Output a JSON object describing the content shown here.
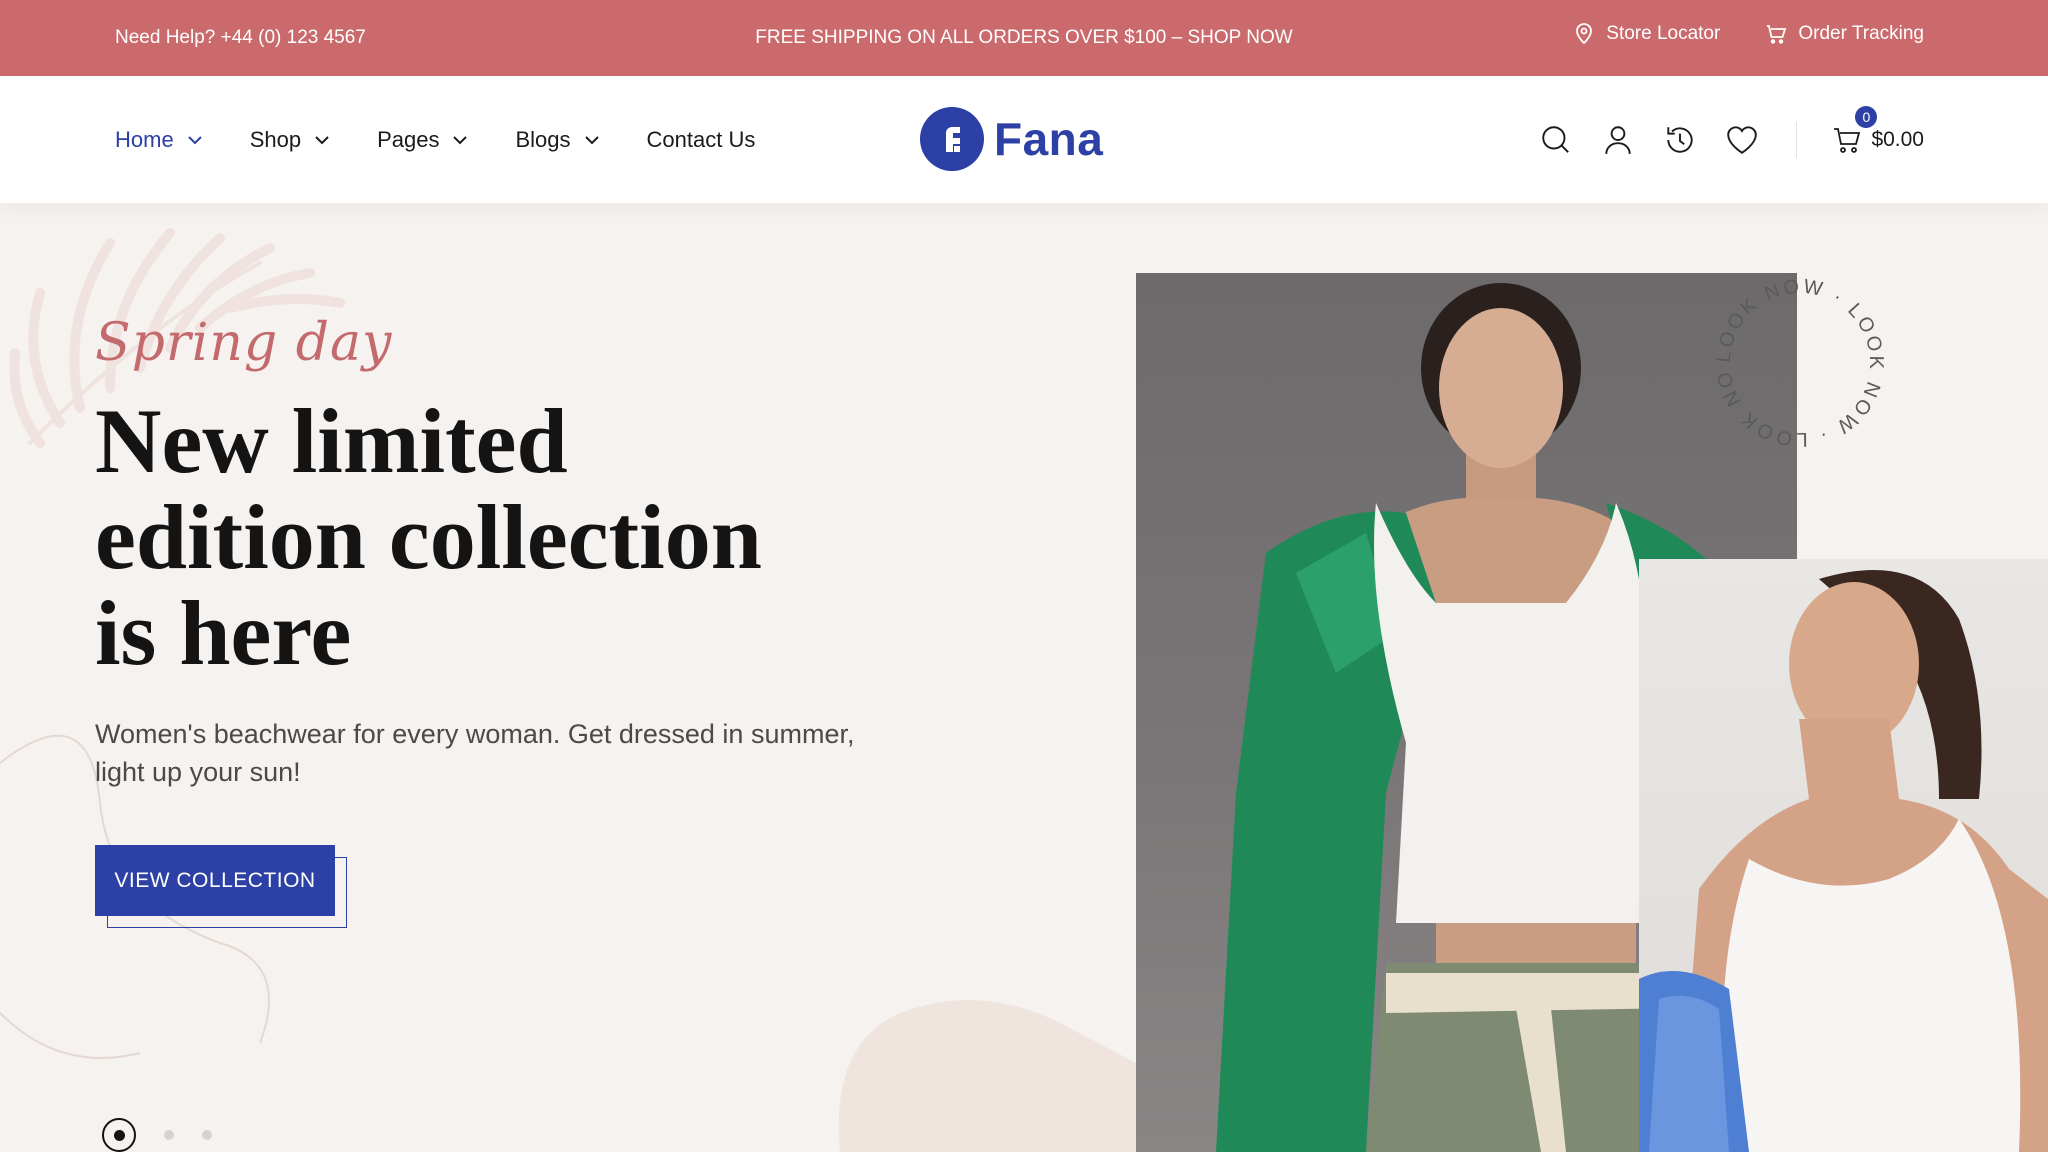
{
  "topbar": {
    "help": "Need Help? +44 (0) 123 4567",
    "promo": "FREE SHIPPING ON ALL ORDERS OVER $100  –  SHOP NOW",
    "store_locator": "Store Locator",
    "order_tracking": "Order Tracking"
  },
  "nav": {
    "items": [
      {
        "label": "Home",
        "has_dropdown": true,
        "active": true
      },
      {
        "label": "Shop",
        "has_dropdown": true
      },
      {
        "label": "Pages",
        "has_dropdown": true
      },
      {
        "label": "Blogs",
        "has_dropdown": true
      },
      {
        "label": "Contact Us",
        "has_dropdown": false
      }
    ]
  },
  "logo": {
    "text": "Fana"
  },
  "header_icons": [
    "search-icon",
    "user-icon",
    "history-icon",
    "heart-icon",
    "cart-icon"
  ],
  "cart": {
    "count": "0",
    "total": "$0.00"
  },
  "hero": {
    "script": "Spring day",
    "headline": [
      "New limited",
      "edition collection",
      "is here"
    ],
    "subtext": "Women's beachwear for every woman. Get dressed in summer, light up your sun!",
    "cta": "VIEW COLLECTION",
    "circle_text": "LOOK NOW · LOOK NOW · LOOK NOW ·",
    "slides": 3,
    "active_slide": 1
  },
  "colors": {
    "topbar": "#cb6a6d",
    "brand": "#2c40a6",
    "hero_bg": "#f5f2ef",
    "script": "#c46a6d"
  }
}
